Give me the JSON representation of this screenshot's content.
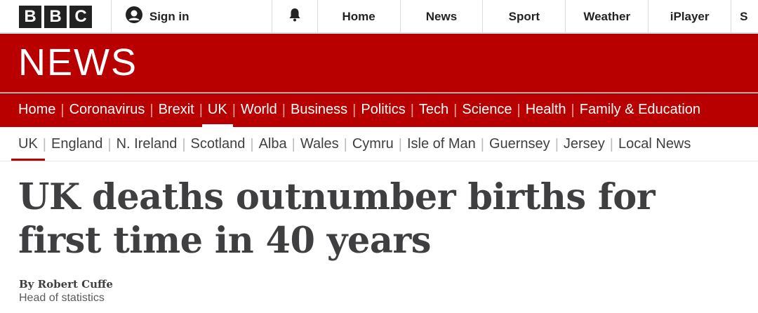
{
  "masthead": {
    "logo_letters": [
      "B",
      "B",
      "C"
    ],
    "signin_label": "Sign in",
    "nav": [
      "Home",
      "News",
      "Sport",
      "Weather",
      "iPlayer",
      "S"
    ]
  },
  "news_banner": {
    "title": "NEWS"
  },
  "sections": [
    "Home",
    "Coronavirus",
    "Brexit",
    "UK",
    "World",
    "Business",
    "Politics",
    "Tech",
    "Science",
    "Health",
    "Family & Education"
  ],
  "subsections": [
    "UK",
    "England",
    "N. Ireland",
    "Scotland",
    "Alba",
    "Wales",
    "Cymru",
    "Isle of Man",
    "Guernsey",
    "Jersey",
    "Local News"
  ],
  "article": {
    "headline": "UK deaths outnumber births for first time in 40 years",
    "byline": "By Robert Cuffe",
    "role": "Head of statistics"
  },
  "colors": {
    "brand_red": "#b80000",
    "text": "#3f3f42"
  }
}
